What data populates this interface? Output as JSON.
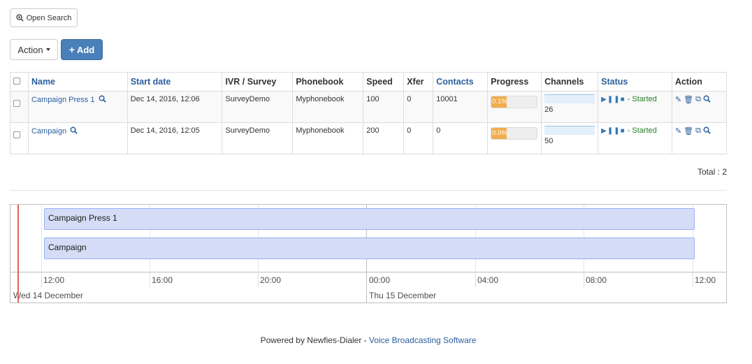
{
  "toolbar": {
    "open_search_label": "Open Search",
    "action_label": "Action",
    "add_label": "Add"
  },
  "table": {
    "headers": {
      "name": "Name",
      "start_date": "Start date",
      "ivr": "IVR / Survey",
      "phonebook": "Phonebook",
      "speed": "Speed",
      "xfer": "Xfer",
      "contacts": "Contacts",
      "progress": "Progress",
      "channels": "Channels",
      "status": "Status",
      "action": "Action"
    },
    "rows": [
      {
        "name": "Campaign Press 1",
        "start_date": "Dec 14, 2016, 12:06",
        "ivr": "SurveyDemo",
        "phonebook": "Myphonebook",
        "speed": "100",
        "xfer": "0",
        "contacts": "10001",
        "progress": "0.1%",
        "channels": "26",
        "status": "- Started"
      },
      {
        "name": "Campaign",
        "start_date": "Dec 14, 2016, 12:05",
        "ivr": "SurveyDemo",
        "phonebook": "Myphonebook",
        "speed": "200",
        "xfer": "0",
        "contacts": "0",
        "progress": "0.0%",
        "channels": "50",
        "status": "- Started"
      }
    ],
    "total": "Total : 2"
  },
  "timeline": {
    "items": [
      "Campaign Press 1",
      "Campaign"
    ],
    "minor_labels": [
      "12:00",
      "16:00",
      "20:00",
      "00:00",
      "04:00",
      "08:00",
      "12:00"
    ],
    "major_labels": [
      "Wed 14 December",
      "Thu 15 December"
    ]
  },
  "footer": {
    "prefix": "Powered by Newfies-Dialer - ",
    "link": "Voice Broadcasting Software"
  },
  "colors": {
    "link": "#2a5f9e",
    "add_button": "#4a80b9",
    "progress_fill": "#f0ad4e",
    "status_started": "#2a7d2a",
    "timeline_item": "#d5ddf6",
    "timeline_now": "#e0635a"
  }
}
